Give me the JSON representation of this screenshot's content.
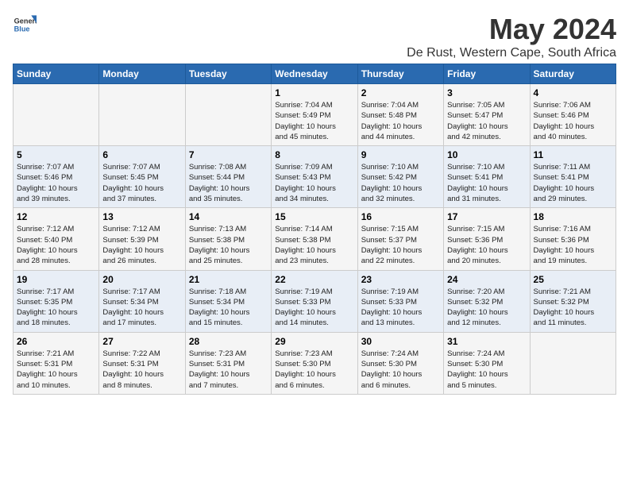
{
  "header": {
    "logo_general": "General",
    "logo_blue": "Blue",
    "title": "May 2024",
    "subtitle": "De Rust, Western Cape, South Africa"
  },
  "days_of_week": [
    "Sunday",
    "Monday",
    "Tuesday",
    "Wednesday",
    "Thursday",
    "Friday",
    "Saturday"
  ],
  "weeks": [
    [
      {
        "day": "",
        "info": ""
      },
      {
        "day": "",
        "info": ""
      },
      {
        "day": "",
        "info": ""
      },
      {
        "day": "1",
        "info": "Sunrise: 7:04 AM\nSunset: 5:49 PM\nDaylight: 10 hours\nand 45 minutes."
      },
      {
        "day": "2",
        "info": "Sunrise: 7:04 AM\nSunset: 5:48 PM\nDaylight: 10 hours\nand 44 minutes."
      },
      {
        "day": "3",
        "info": "Sunrise: 7:05 AM\nSunset: 5:47 PM\nDaylight: 10 hours\nand 42 minutes."
      },
      {
        "day": "4",
        "info": "Sunrise: 7:06 AM\nSunset: 5:46 PM\nDaylight: 10 hours\nand 40 minutes."
      }
    ],
    [
      {
        "day": "5",
        "info": "Sunrise: 7:07 AM\nSunset: 5:46 PM\nDaylight: 10 hours\nand 39 minutes."
      },
      {
        "day": "6",
        "info": "Sunrise: 7:07 AM\nSunset: 5:45 PM\nDaylight: 10 hours\nand 37 minutes."
      },
      {
        "day": "7",
        "info": "Sunrise: 7:08 AM\nSunset: 5:44 PM\nDaylight: 10 hours\nand 35 minutes."
      },
      {
        "day": "8",
        "info": "Sunrise: 7:09 AM\nSunset: 5:43 PM\nDaylight: 10 hours\nand 34 minutes."
      },
      {
        "day": "9",
        "info": "Sunrise: 7:10 AM\nSunset: 5:42 PM\nDaylight: 10 hours\nand 32 minutes."
      },
      {
        "day": "10",
        "info": "Sunrise: 7:10 AM\nSunset: 5:41 PM\nDaylight: 10 hours\nand 31 minutes."
      },
      {
        "day": "11",
        "info": "Sunrise: 7:11 AM\nSunset: 5:41 PM\nDaylight: 10 hours\nand 29 minutes."
      }
    ],
    [
      {
        "day": "12",
        "info": "Sunrise: 7:12 AM\nSunset: 5:40 PM\nDaylight: 10 hours\nand 28 minutes."
      },
      {
        "day": "13",
        "info": "Sunrise: 7:12 AM\nSunset: 5:39 PM\nDaylight: 10 hours\nand 26 minutes."
      },
      {
        "day": "14",
        "info": "Sunrise: 7:13 AM\nSunset: 5:38 PM\nDaylight: 10 hours\nand 25 minutes."
      },
      {
        "day": "15",
        "info": "Sunrise: 7:14 AM\nSunset: 5:38 PM\nDaylight: 10 hours\nand 23 minutes."
      },
      {
        "day": "16",
        "info": "Sunrise: 7:15 AM\nSunset: 5:37 PM\nDaylight: 10 hours\nand 22 minutes."
      },
      {
        "day": "17",
        "info": "Sunrise: 7:15 AM\nSunset: 5:36 PM\nDaylight: 10 hours\nand 20 minutes."
      },
      {
        "day": "18",
        "info": "Sunrise: 7:16 AM\nSunset: 5:36 PM\nDaylight: 10 hours\nand 19 minutes."
      }
    ],
    [
      {
        "day": "19",
        "info": "Sunrise: 7:17 AM\nSunset: 5:35 PM\nDaylight: 10 hours\nand 18 minutes."
      },
      {
        "day": "20",
        "info": "Sunrise: 7:17 AM\nSunset: 5:34 PM\nDaylight: 10 hours\nand 17 minutes."
      },
      {
        "day": "21",
        "info": "Sunrise: 7:18 AM\nSunset: 5:34 PM\nDaylight: 10 hours\nand 15 minutes."
      },
      {
        "day": "22",
        "info": "Sunrise: 7:19 AM\nSunset: 5:33 PM\nDaylight: 10 hours\nand 14 minutes."
      },
      {
        "day": "23",
        "info": "Sunrise: 7:19 AM\nSunset: 5:33 PM\nDaylight: 10 hours\nand 13 minutes."
      },
      {
        "day": "24",
        "info": "Sunrise: 7:20 AM\nSunset: 5:32 PM\nDaylight: 10 hours\nand 12 minutes."
      },
      {
        "day": "25",
        "info": "Sunrise: 7:21 AM\nSunset: 5:32 PM\nDaylight: 10 hours\nand 11 minutes."
      }
    ],
    [
      {
        "day": "26",
        "info": "Sunrise: 7:21 AM\nSunset: 5:31 PM\nDaylight: 10 hours\nand 10 minutes."
      },
      {
        "day": "27",
        "info": "Sunrise: 7:22 AM\nSunset: 5:31 PM\nDaylight: 10 hours\nand 8 minutes."
      },
      {
        "day": "28",
        "info": "Sunrise: 7:23 AM\nSunset: 5:31 PM\nDaylight: 10 hours\nand 7 minutes."
      },
      {
        "day": "29",
        "info": "Sunrise: 7:23 AM\nSunset: 5:30 PM\nDaylight: 10 hours\nand 6 minutes."
      },
      {
        "day": "30",
        "info": "Sunrise: 7:24 AM\nSunset: 5:30 PM\nDaylight: 10 hours\nand 6 minutes."
      },
      {
        "day": "31",
        "info": "Sunrise: 7:24 AM\nSunset: 5:30 PM\nDaylight: 10 hours\nand 5 minutes."
      },
      {
        "day": "",
        "info": ""
      }
    ]
  ]
}
